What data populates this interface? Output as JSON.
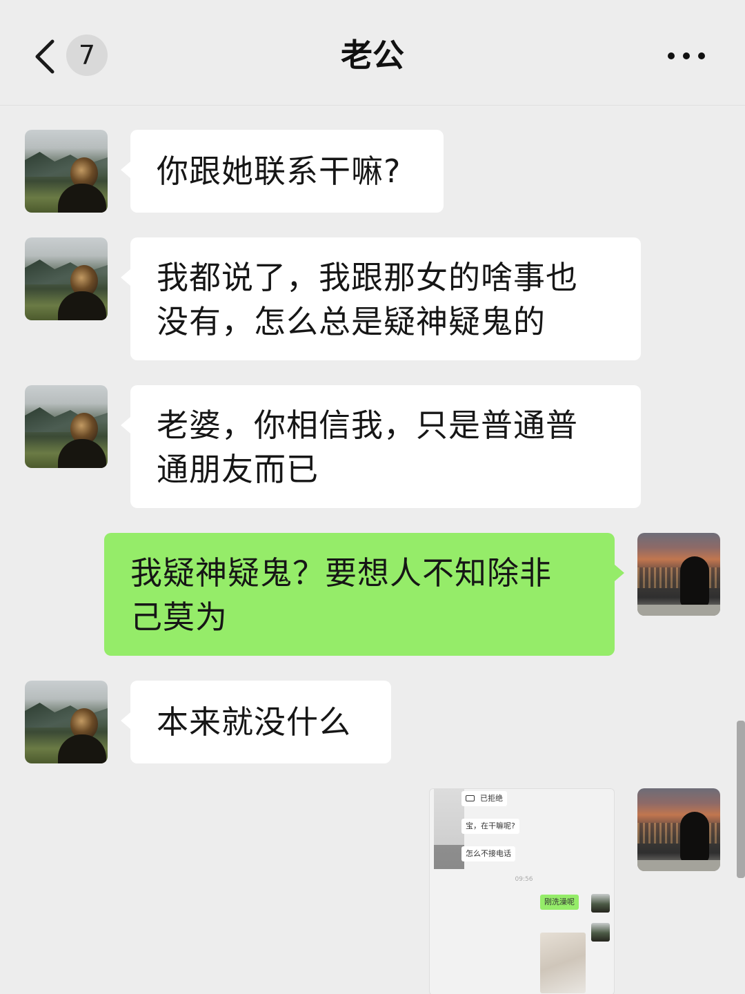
{
  "header": {
    "back_icon": "chevron-left-icon",
    "unread_count": "7",
    "title": "老公",
    "more_icon": "more-horizontal-icon"
  },
  "messages": [
    {
      "side": "left",
      "sender": "contact",
      "text_lines": [
        "你跟她联系干嘛?"
      ]
    },
    {
      "side": "left",
      "sender": "contact",
      "text_lines": [
        "我都说了，我跟那女的啥事也",
        "没有，怎么总是疑神疑鬼的"
      ]
    },
    {
      "side": "left",
      "sender": "contact",
      "text_lines": [
        "老婆，你相信我，只是普通普",
        "通朋友而已"
      ]
    },
    {
      "side": "right",
      "sender": "me",
      "text_lines": [
        "我疑神疑鬼？要想人不知除非",
        "己莫为"
      ]
    },
    {
      "side": "left",
      "sender": "contact",
      "text_lines": [
        "本来就没什么"
      ]
    },
    {
      "side": "right",
      "sender": "me",
      "type": "image",
      "image_content": {
        "call_status": "已拒绝",
        "messages": [
          "宝，在干嘛呢?",
          "怎么不接电话"
        ],
        "time": "09:56",
        "reply": "刚洗澡呢"
      }
    }
  ],
  "colors": {
    "background": "#ededed",
    "incoming_bubble": "#ffffff",
    "outgoing_bubble": "#95ec69",
    "text": "#161616"
  }
}
